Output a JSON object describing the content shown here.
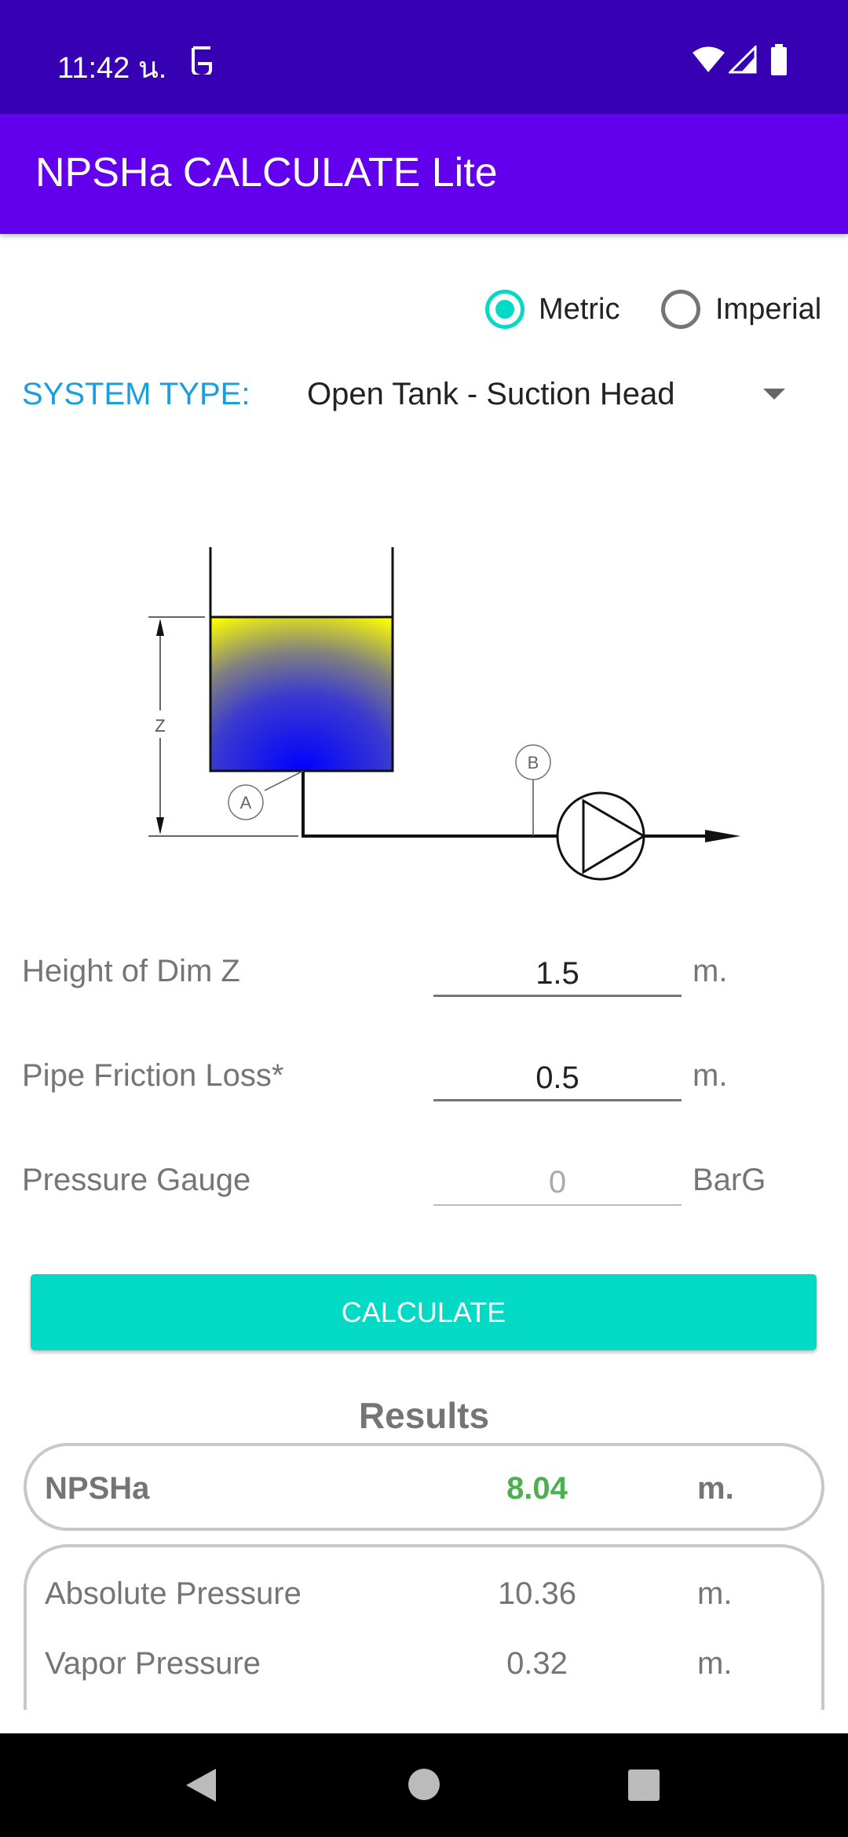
{
  "status_bar": {
    "time": "11:42 น.",
    "icons": [
      "notification-icon",
      "wifi-icon",
      "signal-icon",
      "battery-icon"
    ]
  },
  "app_bar": {
    "title": "NPSHa CALCULATE Lite"
  },
  "units": {
    "options": [
      {
        "label": "Metric",
        "selected": true
      },
      {
        "label": "Imperial",
        "selected": false
      }
    ]
  },
  "system_type": {
    "label": "SYSTEM TYPE:",
    "value": "Open Tank - Suction Head"
  },
  "diagram": {
    "dim_label": "Z",
    "point_a": "A",
    "point_b": "B"
  },
  "fields": [
    {
      "label": "Height of Dim Z",
      "value": "1.5",
      "unit": "m."
    },
    {
      "label": "Pipe Friction Loss*",
      "value": "0.5",
      "unit": "m."
    },
    {
      "label": "Pressure Gauge",
      "value": "0",
      "unit": "BarG",
      "enabled": false
    }
  ],
  "calculate_label": "CALCULATE",
  "results": {
    "heading": "Results",
    "npsha": {
      "label": "NPSHa",
      "value": "8.04",
      "unit": "m."
    },
    "rows": [
      {
        "label": "Absolute Pressure",
        "value": "10.36",
        "unit": "m."
      },
      {
        "label": "Vapor Pressure",
        "value": "0.32",
        "unit": "m."
      }
    ]
  },
  "colors": {
    "status": "#3700b3",
    "primary": "#6200ee",
    "accent": "#03dac5",
    "label_blue": "#1a9ee0",
    "result_green": "#4caf50"
  }
}
